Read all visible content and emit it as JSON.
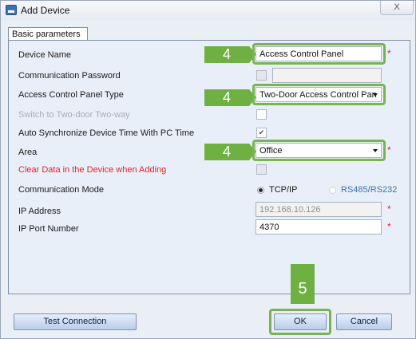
{
  "window": {
    "title": "Add Device",
    "close_glyph": "X"
  },
  "tab": {
    "label": "Basic parameters"
  },
  "fields": {
    "device_name": {
      "label": "Device Name",
      "value": "Access Control Panel"
    },
    "comm_password": {
      "label": "Communication Password",
      "value": ""
    },
    "panel_type": {
      "label": "Access Control Panel Type",
      "value": "Two-Door Access Control Pan"
    },
    "switch_two_door": {
      "label": "Switch to Two-door Two-way"
    },
    "auto_sync": {
      "label": "Auto Synchronize Device Time With PC Time",
      "checked": true
    },
    "area": {
      "label": "Area",
      "value": "Office"
    },
    "clear_data": {
      "label": "Clear Data in the Device when Adding",
      "checked": false
    },
    "comm_mode": {
      "label": "Communication Mode",
      "options": [
        "TCP/IP",
        "RS485/RS232"
      ],
      "selected": "TCP/IP"
    },
    "ip_address": {
      "label": "IP Address",
      "value": "192.168.10.126"
    },
    "ip_port": {
      "label": "IP Port Number",
      "value": "4370"
    }
  },
  "required_marker": "*",
  "checkmark": "✔",
  "annotations": {
    "step_four": "4",
    "step_five": "5",
    "color": "#6fb043"
  },
  "buttons": {
    "test_connection": "Test Connection",
    "ok": "OK",
    "cancel": "Cancel"
  }
}
